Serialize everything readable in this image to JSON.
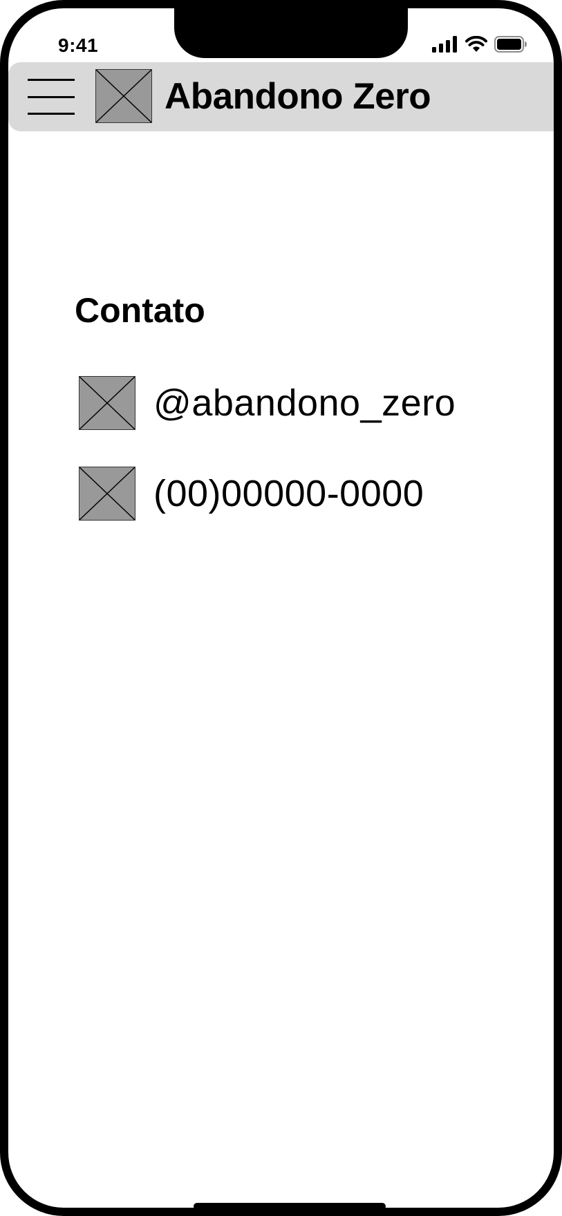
{
  "status_bar": {
    "time": "9:41"
  },
  "header": {
    "title": "Abandono Zero",
    "menu_icon": "hamburger-menu-icon",
    "logo": "image-placeholder"
  },
  "contact": {
    "title": "Contato",
    "items": [
      {
        "icon": "image-placeholder",
        "text": "@abandono_zero"
      },
      {
        "icon": "image-placeholder",
        "text": "(00)00000-0000"
      }
    ]
  },
  "colors": {
    "header_background": "#d9d9d9",
    "placeholder_fill": "#999999",
    "frame": "#000000",
    "background": "#ffffff"
  }
}
